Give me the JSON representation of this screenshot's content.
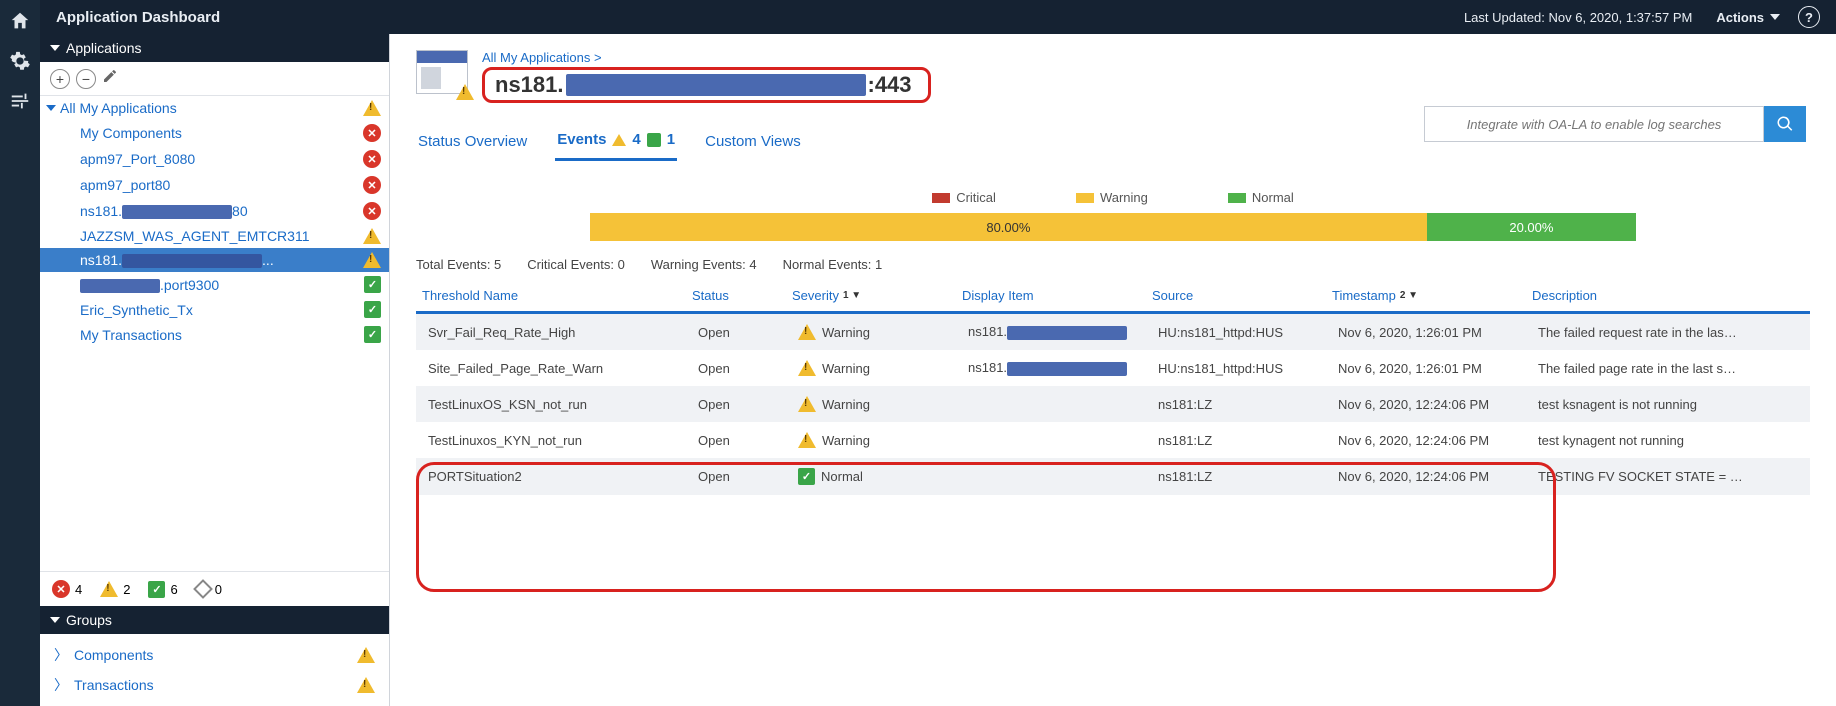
{
  "header": {
    "title": "Application Dashboard",
    "last_updated": "Last Updated: Nov 6, 2020, 1:37:57 PM",
    "actions_label": "Actions"
  },
  "sidebar": {
    "applications": {
      "header": "Applications",
      "root": "All My Applications",
      "items": [
        {
          "label": "My Components",
          "status": "critical"
        },
        {
          "label": "apm97_Port_8080",
          "status": "critical"
        },
        {
          "label": "apm97_port80",
          "status": "critical"
        },
        {
          "label_pre": "ns181.",
          "label_suf": "80",
          "status": "critical",
          "redacted": true
        },
        {
          "label": "JAZZSM_WAS_AGENT_EMTCR311",
          "status": "warning"
        },
        {
          "label_pre": "ns181.",
          "label_suf": "...",
          "status": "warning",
          "redacted": true,
          "selected": true
        },
        {
          "label_suf": ".port9300",
          "status": "normal",
          "redacted": true
        },
        {
          "label": "Eric_Synthetic_Tx",
          "status": "normal"
        },
        {
          "label": "My Transactions",
          "status": "normal"
        }
      ],
      "counts": {
        "critical": "4",
        "warning": "2",
        "normal": "6",
        "unknown": "0"
      }
    },
    "groups": {
      "header": "Groups",
      "items": [
        {
          "label": "Components",
          "status": "warning"
        },
        {
          "label": "Transactions",
          "status": "warning"
        }
      ]
    }
  },
  "workspace": {
    "breadcrumb": "All My Applications >",
    "title_prefix": "ns181.",
    "title_suffix": ":443",
    "search_placeholder": "Integrate with OA-LA to enable log searches",
    "tabs": {
      "status": "Status Overview",
      "events": "Events",
      "events_warn": "4",
      "events_norm": "1",
      "custom": "Custom Views"
    },
    "legend": {
      "critical": "Critical",
      "warning": "Warning",
      "normal": "Normal"
    },
    "bar": {
      "warning_pct": "80.00%",
      "normal_pct": "20.00%"
    },
    "totals": {
      "total": "Total Events: 5",
      "critical": "Critical Events: 0",
      "warning": "Warning Events: 4",
      "normal": "Normal Events: 1"
    },
    "columns": {
      "threshold": "Threshold Name",
      "status": "Status",
      "severity": "Severity",
      "display": "Display Item",
      "source": "Source",
      "timestamp": "Timestamp",
      "description": "Description"
    },
    "sort": {
      "severity": "1 ▼",
      "timestamp": "2 ▼"
    },
    "rows": [
      {
        "threshold": "Svr_Fail_Req_Rate_High",
        "status": "Open",
        "severity": "Warning",
        "display_pre": "ns181.",
        "display_redact": true,
        "source": "HU:ns181_httpd:HUS",
        "timestamp": "Nov 6, 2020, 1:26:01 PM",
        "description": "The failed request rate in the las…"
      },
      {
        "threshold": "Site_Failed_Page_Rate_Warn",
        "status": "Open",
        "severity": "Warning",
        "display_pre": "ns181.",
        "display_redact": true,
        "source": "HU:ns181_httpd:HUS",
        "timestamp": "Nov 6, 2020, 1:26:01 PM",
        "description": "The failed page rate in the last s…"
      },
      {
        "threshold": "TestLinuxOS_KSN_not_run",
        "status": "Open",
        "severity": "Warning",
        "display_pre": "",
        "display_redact": false,
        "source": "ns181:LZ",
        "timestamp": "Nov 6, 2020, 12:24:06 PM",
        "description": "test ksnagent is not running"
      },
      {
        "threshold": "TestLinuxos_KYN_not_run",
        "status": "Open",
        "severity": "Warning",
        "display_pre": "",
        "display_redact": false,
        "source": "ns181:LZ",
        "timestamp": "Nov 6, 2020, 12:24:06 PM",
        "description": "test kynagent not running"
      },
      {
        "threshold": "PORTSituation2",
        "status": "Open",
        "severity": "Normal",
        "display_pre": "",
        "display_redact": false,
        "source": "ns181:LZ",
        "timestamp": "Nov 6, 2020, 12:24:06 PM",
        "description": "TESTING FV SOCKET STATE = …"
      }
    ]
  }
}
